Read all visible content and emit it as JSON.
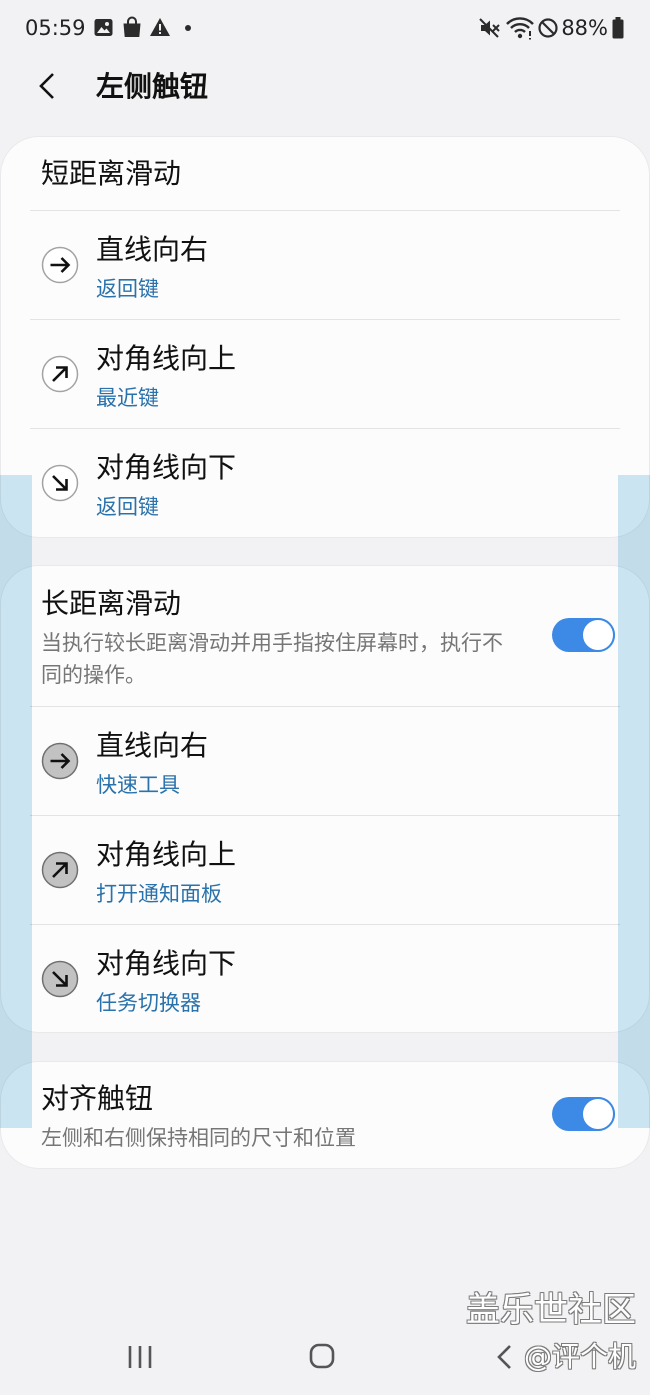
{
  "status_bar": {
    "time": "05:59",
    "battery_percent": "88%",
    "left_icons": [
      "gallery-icon",
      "shopping-bag-icon",
      "warning-icon",
      "notification-dot-icon"
    ],
    "right_icons": [
      "mute-icon",
      "wifi-icon",
      "do-not-disturb-icon",
      "battery-icon"
    ]
  },
  "header": {
    "title": "左侧触钮",
    "back_icon": "chevron-left-icon"
  },
  "short_swipe": {
    "title": "短距离滑动",
    "items": [
      {
        "title": "直线向右",
        "action": "返回键",
        "icon": "arrow-right-icon"
      },
      {
        "title": "对角线向上",
        "action": "最近键",
        "icon": "arrow-up-right-icon"
      },
      {
        "title": "对角线向下",
        "action": "返回键",
        "icon": "arrow-down-right-icon"
      }
    ]
  },
  "long_swipe": {
    "title": "长距离滑动",
    "description": "当执行较长距离滑动并用手指按住屏幕时，执行不同的操作。",
    "enabled": true,
    "items": [
      {
        "title": "直线向右",
        "action": "快速工具",
        "icon": "arrow-right-icon"
      },
      {
        "title": "对角线向上",
        "action": "打开通知面板",
        "icon": "arrow-up-right-icon"
      },
      {
        "title": "对角线向下",
        "action": "任务切换器",
        "icon": "arrow-down-right-icon"
      }
    ]
  },
  "align_buttons": {
    "title": "对齐触钮",
    "description": "左侧和右侧保持相同的尺寸和位置",
    "enabled": true
  },
  "watermark": {
    "line1": "盖乐世社区",
    "line2": "@评个机"
  },
  "nav_bar": {
    "icons": [
      "recent-apps-icon",
      "home-icon",
      "back-icon"
    ]
  },
  "colors": {
    "accent": "#3d8ae6",
    "action_text": "#2a72ab",
    "page_background": "#f2f2f4",
    "card_background": "#fcfcfc",
    "handle_overlay": "#cde8f4"
  }
}
